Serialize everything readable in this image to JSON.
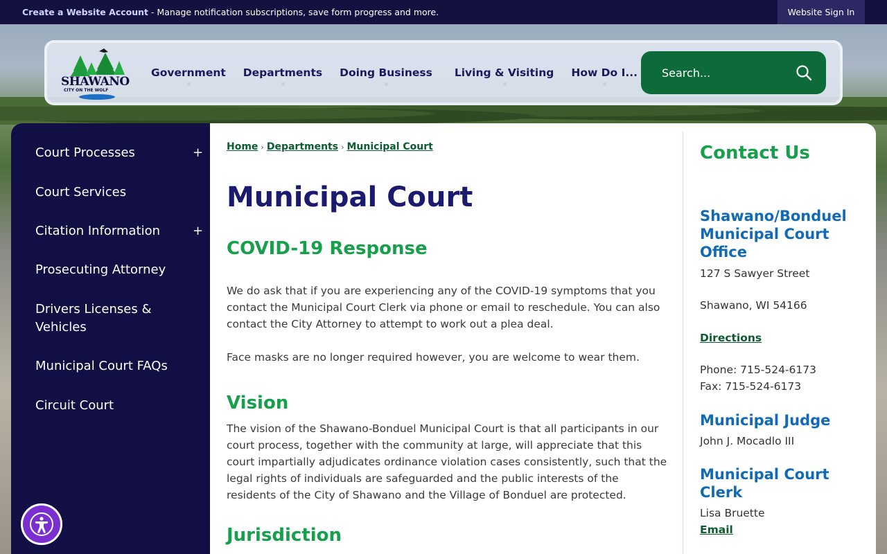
{
  "topbar": {
    "create_link": "Create a Website Account",
    "message": " - Manage notification subscriptions, save form progress and more.",
    "signin": "Website Sign In"
  },
  "logo": {
    "word": "SHAWANO",
    "sub": "CITY ON THE WOLF"
  },
  "nav": [
    {
      "label": "Government"
    },
    {
      "label": "Departments"
    },
    {
      "label": "Doing Business"
    },
    {
      "label": "Living & Visiting"
    },
    {
      "label": "How Do I..."
    }
  ],
  "search": {
    "placeholder": "Search...",
    "icon": "search-icon"
  },
  "sidebar": [
    {
      "label": "Court Processes",
      "expand": "+"
    },
    {
      "label": "Court Services"
    },
    {
      "label": "Citation Information",
      "expand": "+"
    },
    {
      "label": "Prosecuting Attorney"
    },
    {
      "label": "Drivers Licenses & Vehicles"
    },
    {
      "label": "Municipal Court FAQs"
    },
    {
      "label": "Circuit Court"
    }
  ],
  "breadcrumb": [
    "Home",
    "Departments",
    "Municipal Court"
  ],
  "breadcrumb_sep": "›",
  "page_title": "Municipal Court",
  "sections": {
    "covid_title": "COVID-19 Response",
    "covid_p1": "We do ask that if you are experiencing any of the COVID-19 symptoms that you contact the Municipal Court Clerk via phone or email to reschedule.  You can also contact the City Attorney to attempt to work out a plea deal.",
    "covid_p2": "Face masks are no longer required however, you are welcome to wear them.",
    "vision_title": "Vision",
    "vision_p": "The vision of the Shawano-Bonduel Municipal Court is that all participants in our court process, together with the community at large, will appreciate that this court impartially adjudicates ordinance violation cases consistently, such that the legal rights of individuals are safeguarded and the public interests of the residents of the City of Shawano and the Village of Bonduel are protected.",
    "jurisdiction_title": "Jurisdiction"
  },
  "contact": {
    "title": "Contact Us",
    "office_title": "Shawano/Bonduel Municipal Court Office",
    "address1": "127 S Sawyer Street",
    "address2": "Shawano, WI 54166",
    "directions": "Directions",
    "phone": "Phone: 715-524-6173",
    "fax": "Fax: 715-524-6173",
    "judge_title": "Municipal Judge",
    "judge_name": "John J. Mocadlo III",
    "clerk_title": "Municipal Court Clerk",
    "clerk_name": "Lisa Bruette",
    "email": "Email"
  },
  "colors": {
    "navy": "#120f44",
    "green": "#17a04b",
    "search_green": "#0d6b3a",
    "blue": "#136ab4",
    "accessibility": "#7b2fd1"
  }
}
